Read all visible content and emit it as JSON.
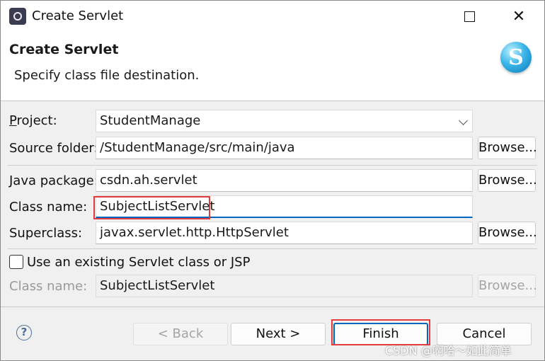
{
  "window": {
    "title": "Create Servlet"
  },
  "header": {
    "title": "Create Servlet",
    "message": "Specify class file destination.",
    "logo_letter": "S"
  },
  "form": {
    "project": {
      "label": "Project:",
      "value": "StudentManage"
    },
    "source_folder": {
      "label": "Source folder:",
      "value": "/StudentManage/src/main/java",
      "browse": "Browse..."
    },
    "java_package": {
      "label": "Java package:",
      "value": "csdn.ah.servlet",
      "browse": "Browse..."
    },
    "class_name": {
      "label": "Class name:",
      "value": "SubjectListServlet"
    },
    "superclass": {
      "label": "Superclass:",
      "value": "javax.servlet.http.HttpServlet",
      "browse": "Browse..."
    },
    "existing": {
      "label": "Use an existing Servlet class or JSP",
      "checked": false
    },
    "existing_class_name": {
      "label": "Class name:",
      "value": "SubjectListServlet",
      "browse": "Browse..."
    }
  },
  "buttons": {
    "help": "?",
    "back": "< Back",
    "next": "Next >",
    "finish": "Finish",
    "cancel": "Cancel"
  },
  "watermark": "CSDN @啊哈～如此简单",
  "colors": {
    "highlight_red": "#e33b3b",
    "focus_blue": "#0067c0"
  }
}
